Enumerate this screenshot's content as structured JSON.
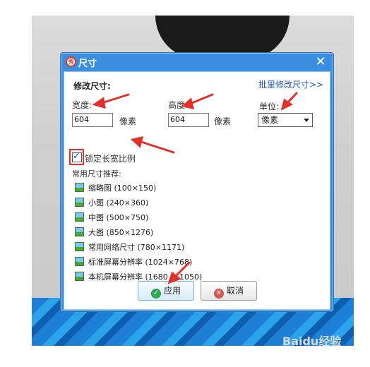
{
  "dialog": {
    "title": "尺寸",
    "close_glyph": "✕",
    "app_icon_text": "秀",
    "section_title": "修改尺寸:",
    "batch_link": "批里修改尺寸>>",
    "width": {
      "label": "宽度:",
      "value": "604",
      "unit": "像素"
    },
    "height": {
      "label": "高度:",
      "value": "604",
      "unit": "像素"
    },
    "unit": {
      "label": "单位:",
      "selected": "像素"
    },
    "lock_ratio": {
      "label": "锁定长宽比例",
      "checked": true
    },
    "recommend_title": "常用尺寸推荐:",
    "recommendations": [
      "缩略图 (100×150)",
      "小图 (240×360)",
      "中图 (500×750)",
      "大图 (850×1276)",
      "常用网络尺寸 (780×1171)",
      "标准屏幕分辨率 (1024×768)",
      "本机屏幕分辨率 (1680 × 1050)"
    ],
    "apply_button": "应用",
    "cancel_button": "取消"
  },
  "watermark": "Baidu经验",
  "colors": {
    "titlebar": "#3c8fe0",
    "arrow": "#e0322a",
    "link": "#1f54b8"
  }
}
